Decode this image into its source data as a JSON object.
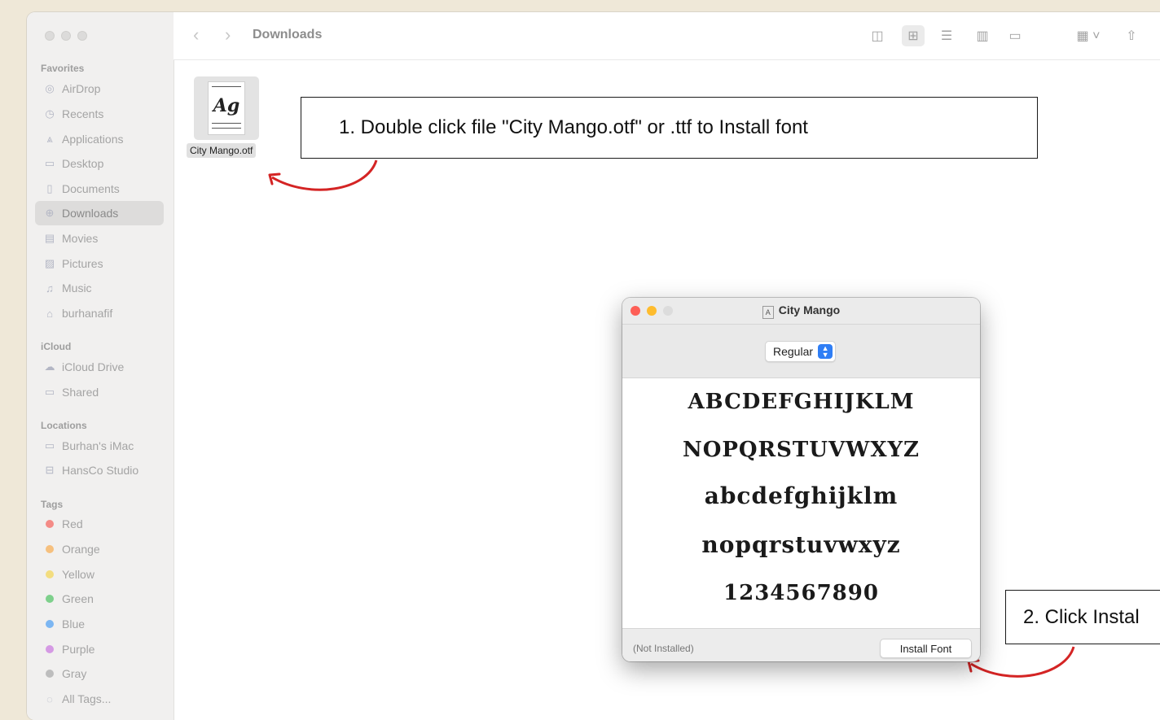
{
  "finder": {
    "title": "Downloads",
    "sidebar": {
      "favorites_title": "Favorites",
      "favorites": [
        {
          "label": "AirDrop",
          "icon": "airdrop-icon"
        },
        {
          "label": "Recents",
          "icon": "clock-icon"
        },
        {
          "label": "Applications",
          "icon": "applications-icon"
        },
        {
          "label": "Desktop",
          "icon": "desktop-icon"
        },
        {
          "label": "Documents",
          "icon": "document-icon"
        },
        {
          "label": "Downloads",
          "icon": "download-icon",
          "selected": true
        },
        {
          "label": "Movies",
          "icon": "film-icon"
        },
        {
          "label": "Pictures",
          "icon": "photo-icon"
        },
        {
          "label": "Music",
          "icon": "music-note-icon"
        },
        {
          "label": "burhanafif",
          "icon": "home-icon"
        }
      ],
      "icloud_title": "iCloud",
      "icloud": [
        {
          "label": "iCloud Drive",
          "icon": "cloud-icon"
        },
        {
          "label": "Shared",
          "icon": "shared-folder-icon"
        }
      ],
      "locations_title": "Locations",
      "locations": [
        {
          "label": "Burhan's iMac",
          "icon": "computer-icon"
        },
        {
          "label": "HansCo Studio",
          "icon": "drive-icon"
        }
      ],
      "tags_title": "Tags",
      "tags": [
        {
          "label": "Red",
          "color": "#f48b86"
        },
        {
          "label": "Orange",
          "color": "#f6c07e"
        },
        {
          "label": "Yellow",
          "color": "#f3dd7f"
        },
        {
          "label": "Green",
          "color": "#7ed08c"
        },
        {
          "label": "Blue",
          "color": "#7cb6f2"
        },
        {
          "label": "Purple",
          "color": "#d59ae4"
        },
        {
          "label": "Gray",
          "color": "#bdbdbd"
        }
      ],
      "all_tags": "All Tags..."
    },
    "file": {
      "name": "City Mango.otf",
      "thumb_text": "Ag"
    }
  },
  "callouts": {
    "step1": "1. Double click file \"City Mango.otf\" or .ttf to Install font",
    "step2": "2. Click Instal"
  },
  "fontbook": {
    "title": "City Mango",
    "style_selected": "Regular",
    "samples": [
      "ABCDEFGHIJKLM",
      "NOPQRSTUVWXYZ",
      "abcdefghijklm",
      "nopqrstuvwxyz",
      "1234567890"
    ],
    "status": "(Not Installed)",
    "install_label": "Install Font"
  },
  "colors": {
    "annotation_arrow": "#d42424",
    "select_accent": "#2f7ef5",
    "traffic_red": "#fe5f57",
    "traffic_yellow": "#febc2e",
    "traffic_gray": "#dcdcdc"
  }
}
